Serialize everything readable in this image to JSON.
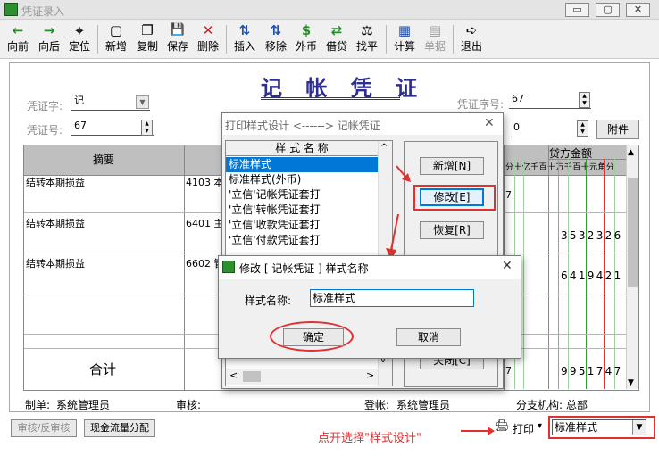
{
  "window": {
    "title": "凭证录入",
    "minimize": "▭",
    "maximize": "▢",
    "close": "✕"
  },
  "toolbar": [
    {
      "label": "向前",
      "icon": "←"
    },
    {
      "label": "向后",
      "icon": "→"
    },
    {
      "label": "定位",
      "icon": "⌖"
    },
    {
      "label": "新增",
      "icon": "▢"
    },
    {
      "label": "复制",
      "icon": "❐"
    },
    {
      "label": "保存",
      "icon": "💾"
    },
    {
      "label": "删除",
      "icon": "✕"
    },
    {
      "label": "插入",
      "icon": "⇅"
    },
    {
      "label": "移除",
      "icon": "⇅"
    },
    {
      "label": "外币",
      "icon": "$"
    },
    {
      "label": "借贷",
      "icon": "⇄"
    },
    {
      "label": "找平",
      "icon": "⚖"
    },
    {
      "label": "计算",
      "icon": "▦"
    },
    {
      "label": "单据",
      "icon": "▤"
    },
    {
      "label": "退出",
      "icon": "➪"
    }
  ],
  "voucher": {
    "title": "记 帐 凭 证",
    "word_label": "凭证字:",
    "word_value": "记",
    "number_label": "凭证号:",
    "number_value": "67",
    "seq_label": "凭证序号:",
    "seq_value": "67",
    "attach_value": "0",
    "attach_button": "附件"
  },
  "grid": {
    "header_summary": "摘要",
    "header_credit": "贷方金额",
    "digit_header": "分十亿千百十万千百十元角分",
    "rows": [
      {
        "summary": "结转本期损益",
        "account": "4103 本",
        "mid": "7",
        "credit": ""
      },
      {
        "summary": "结转本期损益",
        "account": "6401 主",
        "mid": "",
        "credit": "3532326"
      },
      {
        "summary": "结转本期损益",
        "account": "6602 管",
        "mid": "",
        "credit": "6419421"
      },
      {
        "summary": "",
        "account": "",
        "mid": "",
        "credit": ""
      }
    ],
    "total_label": "合计",
    "total_mid": "7",
    "total_credit": "9951747"
  },
  "footer": {
    "maker_label": "制单:",
    "maker": "系统管理员",
    "reviewer_label": "审核:",
    "reviewer": "",
    "poster_label": "登帐:",
    "poster": "系统管理员",
    "branch_label": "分支机构:",
    "branch": "总部"
  },
  "bottom": {
    "review_button": "审核/反审核",
    "cashflow_button": "现金流量分配",
    "hint": "点开选择\"样式设计\"",
    "print_label": "打印",
    "style_select": "标准样式"
  },
  "print_dialog": {
    "title": "打印样式设计 <------> 记帐凭证",
    "list_header": "样 式 名 称",
    "items": [
      "标准样式",
      "标准样式(外币)",
      "'立信'记帐凭证套打",
      "'立信'转帐凭证套打",
      "'立信'收款凭证套打",
      "'立信'付款凭证套打"
    ],
    "selected_index": 0,
    "buttons": {
      "add": "新增[N]",
      "modify": "修改[E]",
      "restore": "恢复[R]",
      "close": "关闭[C]"
    }
  },
  "modify_dialog": {
    "title": "修改 [ 记帐凭证 ] 样式名称",
    "field_label": "样式名称:",
    "field_value": "标准样式",
    "ok": "确定",
    "cancel": "取消"
  },
  "colors": {
    "annotation_red": "#e03030",
    "selection_blue": "#0078d7",
    "title_blue": "#2e2e8e"
  }
}
